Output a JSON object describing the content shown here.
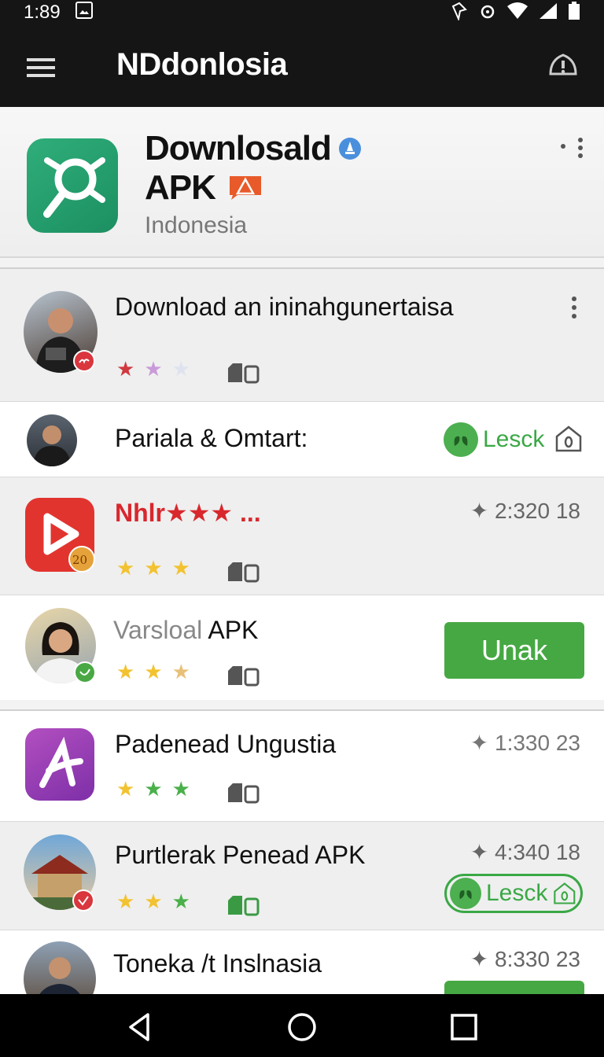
{
  "status": {
    "time": "1:89"
  },
  "appbar": {
    "title": "NDdonlosia"
  },
  "header": {
    "name_line1": "Downlosald",
    "name_line2": "APK",
    "subtitle": "Indonesia"
  },
  "rows": [
    {
      "title": "Download an ininahgunertaisa",
      "stars": [
        "★",
        "★",
        "★"
      ],
      "star_colors": [
        "#d0393f",
        "#c99ad9",
        "#dfe3ef"
      ]
    },
    {
      "title": "Pariala & Omtart:",
      "action_label": "Lesck"
    },
    {
      "title": "Nhlr★★★ ...",
      "meta": "✦ 2:320 18",
      "stars": [
        "★",
        "★",
        "★"
      ],
      "star_colors": [
        "#f2c230",
        "#f2c230",
        "#f2c230"
      ],
      "badge": "20"
    },
    {
      "title_light": "Varsloal",
      "title_dark": "APK",
      "button_label": "Unak",
      "stars": [
        "★",
        "★",
        "★"
      ],
      "star_colors": [
        "#f2c230",
        "#f2c230",
        "#e8c07a"
      ]
    },
    {
      "title": "Padenead Ungustia",
      "meta": "✦ 1:330 23",
      "stars": [
        "★",
        "★",
        "★"
      ],
      "star_colors": [
        "#f2c230",
        "#49b04a",
        "#49b04a"
      ]
    },
    {
      "title": "Purtlerak Penead APK",
      "meta": "✦ 4:340 18",
      "action_label": "Lesck",
      "stars": [
        "★",
        "★",
        "★"
      ],
      "star_colors": [
        "#f2c230",
        "#f2c230",
        "#49b04a"
      ]
    },
    {
      "title": "Toneka /t Inslnasia",
      "meta": "✦ 8:330 23"
    }
  ],
  "colors": {
    "brand_green": "#46a843",
    "appbar_bg": "#151515",
    "header_logo": "#2fae7a"
  }
}
